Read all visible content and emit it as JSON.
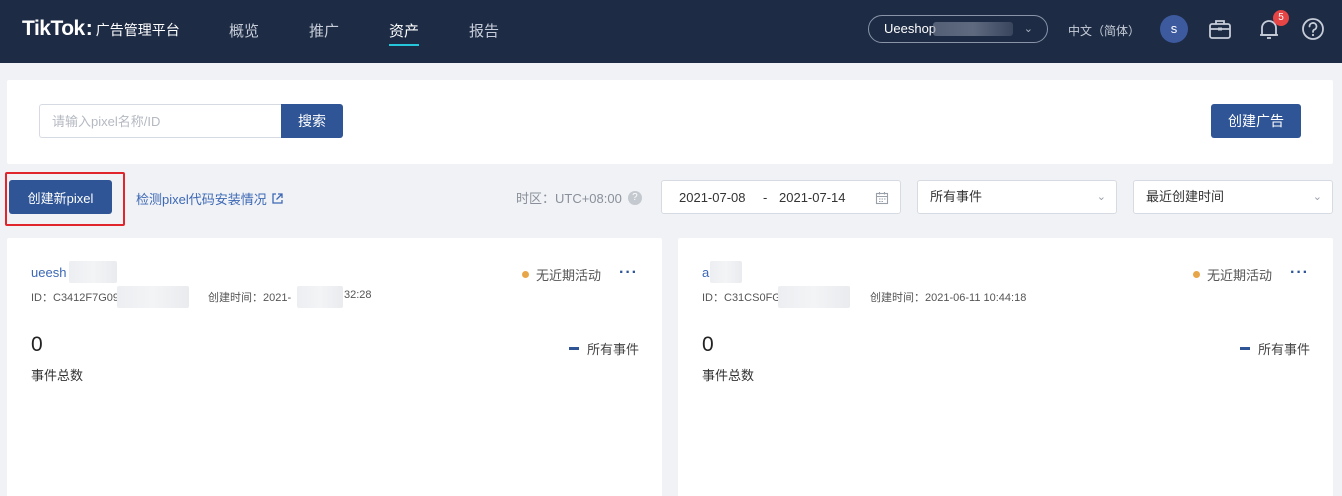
{
  "header": {
    "logo_main": "TikTok",
    "logo_colon": ":",
    "logo_sub": "广告管理平台",
    "nav": [
      {
        "label": "概览"
      },
      {
        "label": "推广"
      },
      {
        "label": "资产"
      },
      {
        "label": "报告"
      }
    ],
    "active_nav": "资产",
    "account": "Ueeshop",
    "language": "中文（简体）",
    "avatar_letter": "s",
    "notification_count": "5"
  },
  "search": {
    "placeholder": "请输入pixel名称/ID",
    "value": "",
    "button_label": "搜索",
    "create_ad_label": "创建广告"
  },
  "toolbar": {
    "create_pixel_label": "创建新pixel",
    "detect_link_label": "检测pixel代码安装情况",
    "timezone_label": "时区：UTC+08:00",
    "help_glyph": "?",
    "date_start": "2021-07-08",
    "date_sep": "-",
    "date_end": "2021-07-14",
    "event_filter": "所有事件",
    "sort_filter": "最近创建时间"
  },
  "pixels": [
    {
      "name": "ueesh",
      "id_label": "ID：C3412F7G09",
      "created_label": "创建时间：2021-",
      "created_tail": "32:28",
      "status": "无近期活动",
      "more": "···",
      "count": "0",
      "count_label": "事件总数",
      "legend": "所有事件"
    },
    {
      "name": "a",
      "id_label": "ID：C31CS0FG",
      "created_label": "创建时间：2021-06-11 10:44:18",
      "created_tail": "",
      "status": "无近期活动",
      "more": "···",
      "count": "0",
      "count_label": "事件总数",
      "legend": "所有事件"
    }
  ],
  "colors": {
    "nav_bg": "#1d2b45",
    "primary": "#2f5596",
    "link": "#3d68b5",
    "status_dot": "#e8a64a",
    "highlight": "#e0262c"
  }
}
